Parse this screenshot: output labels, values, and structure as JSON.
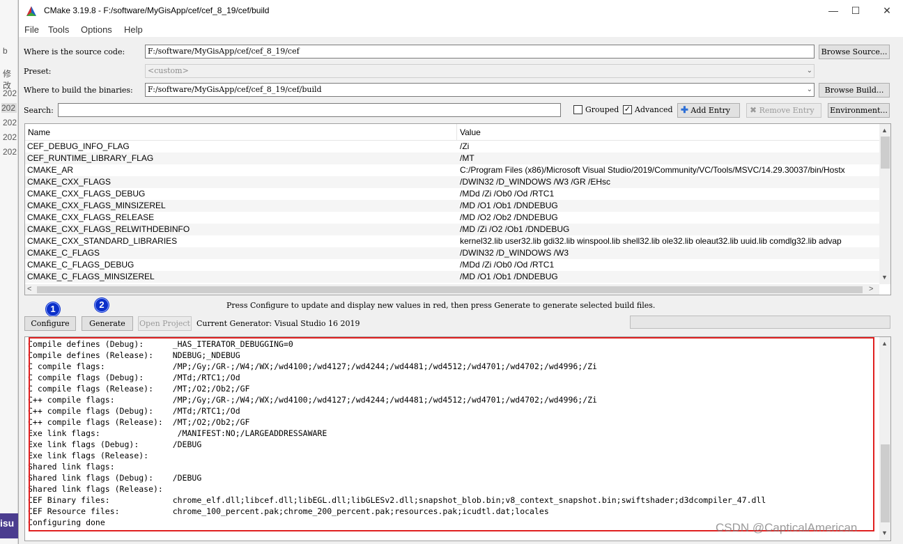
{
  "background_window": {
    "items": [
      "b",
      "修改",
      "202",
      "202",
      "202",
      "202",
      "202"
    ],
    "bottom_label": "isu"
  },
  "window": {
    "title": "CMake 3.19.8 - F:/software/MyGisApp/cef/cef_8_19/cef/build",
    "controls": [
      "—",
      "☐",
      "✕"
    ]
  },
  "menu": [
    "File",
    "Tools",
    "Options",
    "Help"
  ],
  "source": {
    "label": "Where is the source code:",
    "value": "F:/software/MyGisApp/cef/cef_8_19/cef",
    "button": "Browse Source..."
  },
  "preset": {
    "label": "Preset:",
    "value": "<custom>"
  },
  "build": {
    "label": "Where to build the binaries:",
    "value": "F:/software/MyGisApp/cef/cef_8_19/cef/build",
    "button": "Browse Build..."
  },
  "search": {
    "label": "Search:",
    "value": "",
    "grouped_label": "Grouped",
    "grouped_checked": false,
    "advanced_label": "Advanced",
    "advanced_checked": true,
    "add_entry": "Add Entry",
    "remove_entry": "Remove Entry",
    "environment": "Environment..."
  },
  "table": {
    "headers": [
      "Name",
      "Value"
    ],
    "rows": [
      {
        "name": "CEF_DEBUG_INFO_FLAG",
        "value": "/Zi"
      },
      {
        "name": "CEF_RUNTIME_LIBRARY_FLAG",
        "value": "/MT"
      },
      {
        "name": "CMAKE_AR",
        "value": "C:/Program Files (x86)/Microsoft Visual Studio/2019/Community/VC/Tools/MSVC/14.29.30037/bin/Hostx"
      },
      {
        "name": "CMAKE_CXX_FLAGS",
        "value": "/DWIN32 /D_WINDOWS /W3 /GR /EHsc"
      },
      {
        "name": "CMAKE_CXX_FLAGS_DEBUG",
        "value": "/MDd /Zi /Ob0 /Od /RTC1"
      },
      {
        "name": "CMAKE_CXX_FLAGS_MINSIZEREL",
        "value": "/MD /O1 /Ob1 /DNDEBUG"
      },
      {
        "name": "CMAKE_CXX_FLAGS_RELEASE",
        "value": "/MD /O2 /Ob2 /DNDEBUG"
      },
      {
        "name": "CMAKE_CXX_FLAGS_RELWITHDEBINFO",
        "value": "/MD /Zi /O2 /Ob1 /DNDEBUG"
      },
      {
        "name": "CMAKE_CXX_STANDARD_LIBRARIES",
        "value": "kernel32.lib user32.lib gdi32.lib winspool.lib shell32.lib ole32.lib oleaut32.lib uuid.lib comdlg32.lib advap"
      },
      {
        "name": "CMAKE_C_FLAGS",
        "value": "/DWIN32 /D_WINDOWS /W3"
      },
      {
        "name": "CMAKE_C_FLAGS_DEBUG",
        "value": "/MDd /Zi /Ob0 /Od /RTC1"
      },
      {
        "name": "CMAKE_C_FLAGS_MINSIZEREL",
        "value": "/MD /O1 /Ob1 /DNDEBUG"
      }
    ]
  },
  "hint": "Press Configure to update and display new values in red, then press Generate to generate selected build files.",
  "actions": {
    "configure": "Configure",
    "generate": "Generate",
    "open_project": "Open Project",
    "generator": "Current Generator: Visual Studio 16 2019",
    "badge1": "1",
    "badge2": "2"
  },
  "log": {
    "lines": [
      "Compile defines (Debug):      _HAS_ITERATOR_DEBUGGING=0",
      "Compile defines (Release):    NDEBUG;_NDEBUG",
      "C compile flags:              /MP;/Gy;/GR-;/W4;/WX;/wd4100;/wd4127;/wd4244;/wd4481;/wd4512;/wd4701;/wd4702;/wd4996;/Zi",
      "C compile flags (Debug):      /MTd;/RTC1;/Od",
      "C compile flags (Release):    /MT;/O2;/Ob2;/GF",
      "C++ compile flags:            /MP;/Gy;/GR-;/W4;/WX;/wd4100;/wd4127;/wd4244;/wd4481;/wd4512;/wd4701;/wd4702;/wd4996;/Zi",
      "C++ compile flags (Debug):    /MTd;/RTC1;/Od",
      "C++ compile flags (Release):  /MT;/O2;/Ob2;/GF",
      "Exe link flags:                /MANIFEST:NO;/LARGEADDRESSAWARE",
      "Exe link flags (Debug):       /DEBUG",
      "Exe link flags (Release):",
      "Shared link flags:",
      "Shared link flags (Debug):    /DEBUG",
      "Shared link flags (Release):",
      "CEF Binary files:             chrome_elf.dll;libcef.dll;libEGL.dll;libGLESv2.dll;snapshot_blob.bin;v8_context_snapshot.bin;swiftshader;d3dcompiler_47.dll",
      "CEF Resource files:           chrome_100_percent.pak;chrome_200_percent.pak;resources.pak;icudtl.dat;locales",
      "Configuring done"
    ]
  },
  "watermark": "CSDN @CapticalAmerican"
}
